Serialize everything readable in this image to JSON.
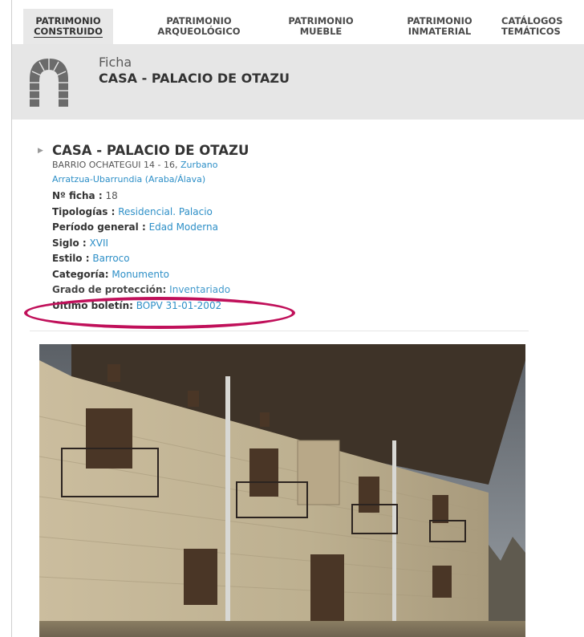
{
  "nav": {
    "items": [
      {
        "line1": "PATRIMONIO",
        "line2": "CONSTRUIDO",
        "active": true
      },
      {
        "line1": "PATRIMONIO",
        "line2": "ARQUEOLÓGICO",
        "active": false
      },
      {
        "line1": "PATRIMONIO",
        "line2": "MUEBLE",
        "active": false
      },
      {
        "line1": "PATRIMONIO",
        "line2": "INMATERIAL",
        "active": false
      },
      {
        "line1": "CATÁLOGOS",
        "line2": "TEMÁTICOS",
        "active": false
      }
    ]
  },
  "header": {
    "label": "Ficha",
    "title": "CASA - PALACIO DE OTAZU",
    "icon": "arch-icon"
  },
  "record": {
    "title": "CASA - PALACIO DE OTAZU",
    "address_prefix": "BARRIO OCHATEGUI 14 - 16,",
    "address_town": "Zurbano",
    "address_muni": "Arratzua-Ubarrundia",
    "address_prov": "(Araba/Álava)",
    "fields": [
      {
        "label": "Nº ficha :",
        "value": "18",
        "link": false
      },
      {
        "label": "Tipologías :",
        "value": "Residencial. Palacio",
        "link": true
      },
      {
        "label": "Período general :",
        "value": "Edad Moderna",
        "link": true
      },
      {
        "label": "Siglo :",
        "value": "XVII",
        "link": true
      },
      {
        "label": "Estilo :",
        "value": "Barroco",
        "link": true
      },
      {
        "label": "Categoría:",
        "value": "Monumento",
        "link": true
      },
      {
        "label": "Grado de protección:",
        "value": "Inventariado",
        "link": true
      },
      {
        "label": "Ultimo boletín:",
        "value": "BOPV 31-01-2002",
        "link": true
      }
    ]
  },
  "colors": {
    "link": "#2d8fc7",
    "highlight": "#c0105a",
    "header_bg": "#e6e6e6"
  }
}
